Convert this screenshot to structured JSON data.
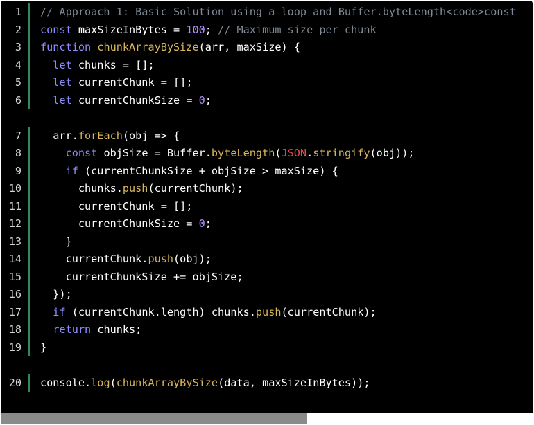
{
  "editor": {
    "lines": [
      {
        "n": "1",
        "tokens": [
          {
            "t": "// Approach 1: Basic Solution using a loop and Buffer.byteLength<code>const ",
            "c": "comment"
          }
        ]
      },
      {
        "n": "2",
        "tokens": [
          {
            "t": "const ",
            "c": "kw"
          },
          {
            "t": "maxSizeInBytes = ",
            "c": "plain"
          },
          {
            "t": "100",
            "c": "num"
          },
          {
            "t": "; ",
            "c": "plain"
          },
          {
            "t": "// Maximum size per chunk",
            "c": "comment"
          }
        ]
      },
      {
        "n": "3",
        "tokens": [
          {
            "t": "function ",
            "c": "kw"
          },
          {
            "t": "chunkArrayBySize",
            "c": "fn"
          },
          {
            "t": "(arr, maxSize) {",
            "c": "plain"
          }
        ]
      },
      {
        "n": "4",
        "tokens": [
          {
            "t": "  ",
            "c": "plain"
          },
          {
            "t": "let ",
            "c": "kw"
          },
          {
            "t": "chunks = [];",
            "c": "plain"
          }
        ]
      },
      {
        "n": "5",
        "tokens": [
          {
            "t": "  ",
            "c": "plain"
          },
          {
            "t": "let ",
            "c": "kw"
          },
          {
            "t": "currentChunk = [];",
            "c": "plain"
          }
        ]
      },
      {
        "n": "6",
        "tokens": [
          {
            "t": "  ",
            "c": "plain"
          },
          {
            "t": "let ",
            "c": "kw"
          },
          {
            "t": "currentChunkSize = ",
            "c": "plain"
          },
          {
            "t": "0",
            "c": "num"
          },
          {
            "t": ";",
            "c": "plain"
          }
        ]
      },
      {
        "gap": true
      },
      {
        "n": "7",
        "tokens": [
          {
            "t": "  arr.",
            "c": "plain"
          },
          {
            "t": "forEach",
            "c": "fn"
          },
          {
            "t": "(obj => {",
            "c": "plain"
          }
        ]
      },
      {
        "n": "8",
        "tokens": [
          {
            "t": "    ",
            "c": "plain"
          },
          {
            "t": "const ",
            "c": "kw"
          },
          {
            "t": "objSize = Buffer.",
            "c": "plain"
          },
          {
            "t": "byteLength",
            "c": "fn"
          },
          {
            "t": "(",
            "c": "plain"
          },
          {
            "t": "JSON",
            "c": "json"
          },
          {
            "t": ".",
            "c": "plain"
          },
          {
            "t": "stringify",
            "c": "fn"
          },
          {
            "t": "(obj));",
            "c": "plain"
          }
        ]
      },
      {
        "n": "9",
        "tokens": [
          {
            "t": "    ",
            "c": "plain"
          },
          {
            "t": "if ",
            "c": "kw"
          },
          {
            "t": "(currentChunkSize + objSize > maxSize) {",
            "c": "plain"
          }
        ]
      },
      {
        "n": "10",
        "tokens": [
          {
            "t": "      chunks.",
            "c": "plain"
          },
          {
            "t": "push",
            "c": "fn"
          },
          {
            "t": "(currentChunk);",
            "c": "plain"
          }
        ]
      },
      {
        "n": "11",
        "tokens": [
          {
            "t": "      currentChunk = [];",
            "c": "plain"
          }
        ]
      },
      {
        "n": "12",
        "tokens": [
          {
            "t": "      currentChunkSize = ",
            "c": "plain"
          },
          {
            "t": "0",
            "c": "num"
          },
          {
            "t": ";",
            "c": "plain"
          }
        ]
      },
      {
        "n": "13",
        "tokens": [
          {
            "t": "    }",
            "c": "plain"
          }
        ]
      },
      {
        "n": "14",
        "tokens": [
          {
            "t": "    currentChunk.",
            "c": "plain"
          },
          {
            "t": "push",
            "c": "fn"
          },
          {
            "t": "(obj);",
            "c": "plain"
          }
        ]
      },
      {
        "n": "15",
        "tokens": [
          {
            "t": "    currentChunkSize += objSize;",
            "c": "plain"
          }
        ]
      },
      {
        "n": "16",
        "tokens": [
          {
            "t": "  });",
            "c": "plain"
          }
        ]
      },
      {
        "n": "17",
        "tokens": [
          {
            "t": "  ",
            "c": "plain"
          },
          {
            "t": "if ",
            "c": "kw"
          },
          {
            "t": "(currentChunk.length) chunks.",
            "c": "plain"
          },
          {
            "t": "push",
            "c": "fn"
          },
          {
            "t": "(currentChunk);",
            "c": "plain"
          }
        ]
      },
      {
        "n": "18",
        "tokens": [
          {
            "t": "  ",
            "c": "plain"
          },
          {
            "t": "return ",
            "c": "kw"
          },
          {
            "t": "chunks;",
            "c": "plain"
          }
        ]
      },
      {
        "n": "19",
        "tokens": [
          {
            "t": "}",
            "c": "plain"
          }
        ]
      },
      {
        "gap": true
      },
      {
        "n": "20",
        "tokens": [
          {
            "t": "console.",
            "c": "plain"
          },
          {
            "t": "log",
            "c": "fn"
          },
          {
            "t": "(",
            "c": "plain"
          },
          {
            "t": "chunkArrayBySize",
            "c": "fn"
          },
          {
            "t": "(data, maxSizeInBytes));",
            "c": "plain"
          }
        ]
      }
    ]
  },
  "scrollbar": {
    "position_fraction": 0.575
  },
  "colors": {
    "background": "#000000",
    "line_marker": "#2e8b57",
    "comment": "#7f8a96",
    "keyword": "#8c8cff",
    "function": "#d8b55a",
    "number": "#b08cff",
    "json": "#e5484d"
  }
}
